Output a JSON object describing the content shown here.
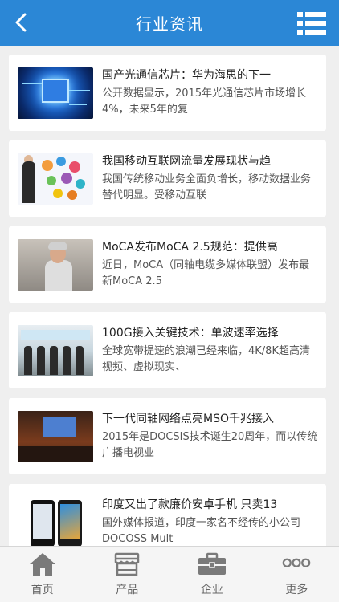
{
  "header": {
    "title": "行业资讯"
  },
  "news": [
    {
      "title": "国产光通信芯片：华为海思的下一",
      "summary": "公开数据显示，2015年光通信芯片市场增长4%，未来5年的复",
      "thumb": "chip"
    },
    {
      "title": "我国移动互联网流量发展现状与趋",
      "summary": "我国传统移动业务全面负增长，移动数据业务替代明显。受移动互联",
      "thumb": "mobile-internet"
    },
    {
      "title": "MoCA发布MoCA 2.5规范：提供高",
      "summary": "近日，MoCA（同轴电缆多媒体联盟）发布最新MoCA 2.5",
      "thumb": "speaker"
    },
    {
      "title": "100G接入关键技术：单波速率选择",
      "summary": "全球宽带提速的浪潮已经来临，4K/8K超高清视频、虚拟现实、",
      "thumb": "panel"
    },
    {
      "title": "下一代同轴网络点亮MSO千兆接入",
      "summary": "2015年是DOCSIS技术诞生20周年，而以传统广播电视业",
      "thumb": "conference"
    },
    {
      "title": "印度又出了款廉价安卓手机 只卖13",
      "summary": "国外媒体报道，印度一家名不经传的小公司DOCOSS Mult",
      "thumb": "phones"
    }
  ],
  "tabbar": [
    {
      "label": "首页",
      "icon": "home-icon"
    },
    {
      "label": "产品",
      "icon": "store-icon"
    },
    {
      "label": "企业",
      "icon": "briefcase-icon"
    },
    {
      "label": "更多",
      "icon": "more-icon"
    }
  ],
  "colors": {
    "header": "#2b87d6",
    "background": "#efefef",
    "tab_icon": "#7a7a7a"
  }
}
